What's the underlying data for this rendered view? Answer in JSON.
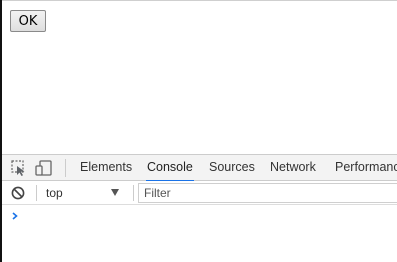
{
  "page": {
    "ok_button_label": "OK"
  },
  "devtools": {
    "tabs": [
      {
        "label": "Elements",
        "active": false
      },
      {
        "label": "Console",
        "active": true
      },
      {
        "label": "Sources",
        "active": false
      },
      {
        "label": "Network",
        "active": false
      },
      {
        "label": "Performanc",
        "active": false
      }
    ],
    "toolbar_icons": [
      "inspect-element-icon",
      "device-toolbar-icon"
    ],
    "console_toolbar": {
      "clear_icon": "clear-console-icon",
      "context_value": "top",
      "filter_placeholder": "Filter"
    },
    "prompt_icon": "console-prompt-icon",
    "accent_color": "#1a73e8"
  }
}
